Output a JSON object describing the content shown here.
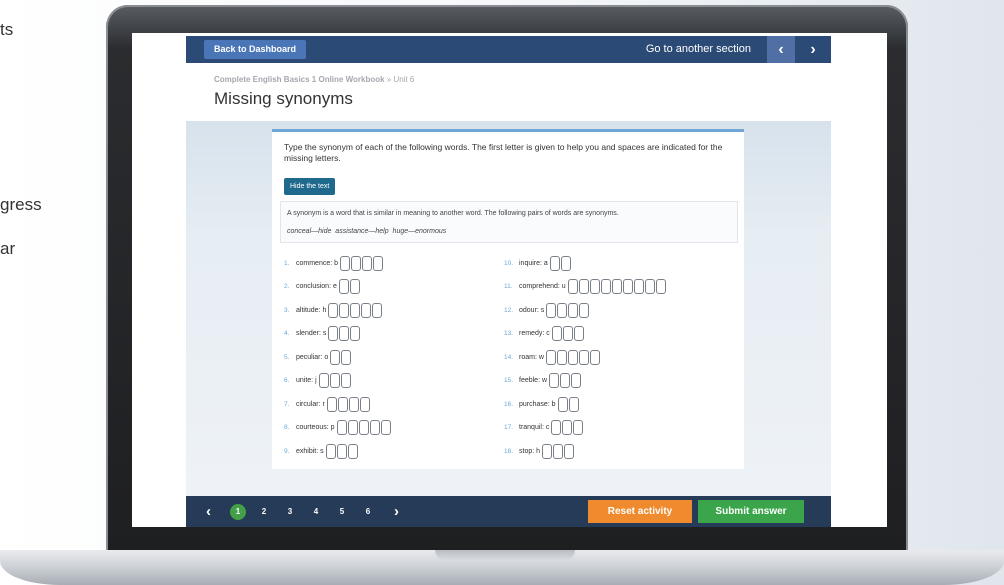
{
  "side_text": [
    "ts",
    "gress",
    "ar"
  ],
  "header": {
    "back_label": "Back to Dashboard",
    "goto_label": "Go to another section",
    "prev_icon": "‹",
    "next_icon": "›"
  },
  "breadcrumb": {
    "workbook": "Complete English Basics 1 Online Workbook",
    "unit": "» Unit 6"
  },
  "page_title": "Missing synonyms",
  "instructions": "Type the synonym of each of the following words. The first letter is given to help you and spaces are indicated for the missing letters.",
  "hide_text_label": "Hide the text",
  "info_text": "A synonym is a word that is similar in meaning to another word. The following pairs of words are synonyms.",
  "examples": "conceal—hide   assistance—help   huge—enormous",
  "questions_left": [
    {
      "num": "1.",
      "word": "commence: b",
      "boxes": 4
    },
    {
      "num": "2.",
      "word": "conclusion: e",
      "boxes": 2
    },
    {
      "num": "3.",
      "word": "altitude: h",
      "boxes": 5
    },
    {
      "num": "4.",
      "word": "slender: s",
      "boxes": 3
    },
    {
      "num": "5.",
      "word": "peculiar: o",
      "boxes": 2
    },
    {
      "num": "6.",
      "word": "unite: j",
      "boxes": 3
    },
    {
      "num": "7.",
      "word": "circular: r",
      "boxes": 4
    },
    {
      "num": "8.",
      "word": "courteous: p",
      "boxes": 5
    },
    {
      "num": "9.",
      "word": "exhibit: s",
      "boxes": 3
    }
  ],
  "questions_right": [
    {
      "num": "10.",
      "word": "inquire: a",
      "boxes": 2
    },
    {
      "num": "11.",
      "word": "comprehend: u",
      "boxes": 9
    },
    {
      "num": "12.",
      "word": "odour: s",
      "boxes": 4
    },
    {
      "num": "13.",
      "word": "remedy: c",
      "boxes": 3
    },
    {
      "num": "14.",
      "word": "roam: w",
      "boxes": 5
    },
    {
      "num": "15.",
      "word": "feeble: w",
      "boxes": 3
    },
    {
      "num": "16.",
      "word": "purchase: b",
      "boxes": 2
    },
    {
      "num": "17.",
      "word": "tranquil: c",
      "boxes": 3
    },
    {
      "num": "18.",
      "word": "stop: h",
      "boxes": 3
    }
  ],
  "pagination": {
    "prev_icon": "‹",
    "next_icon": "›",
    "pages": [
      "1",
      "2",
      "3",
      "4",
      "5",
      "6"
    ],
    "current": "1"
  },
  "footer": {
    "reset_label": "Reset activity",
    "submit_label": "Submit answer"
  },
  "colors": {
    "navy": "#2c4a76",
    "accent_blue": "#4a76b8",
    "reset_orange": "#ef8a2e",
    "submit_green": "#3aa54a"
  }
}
